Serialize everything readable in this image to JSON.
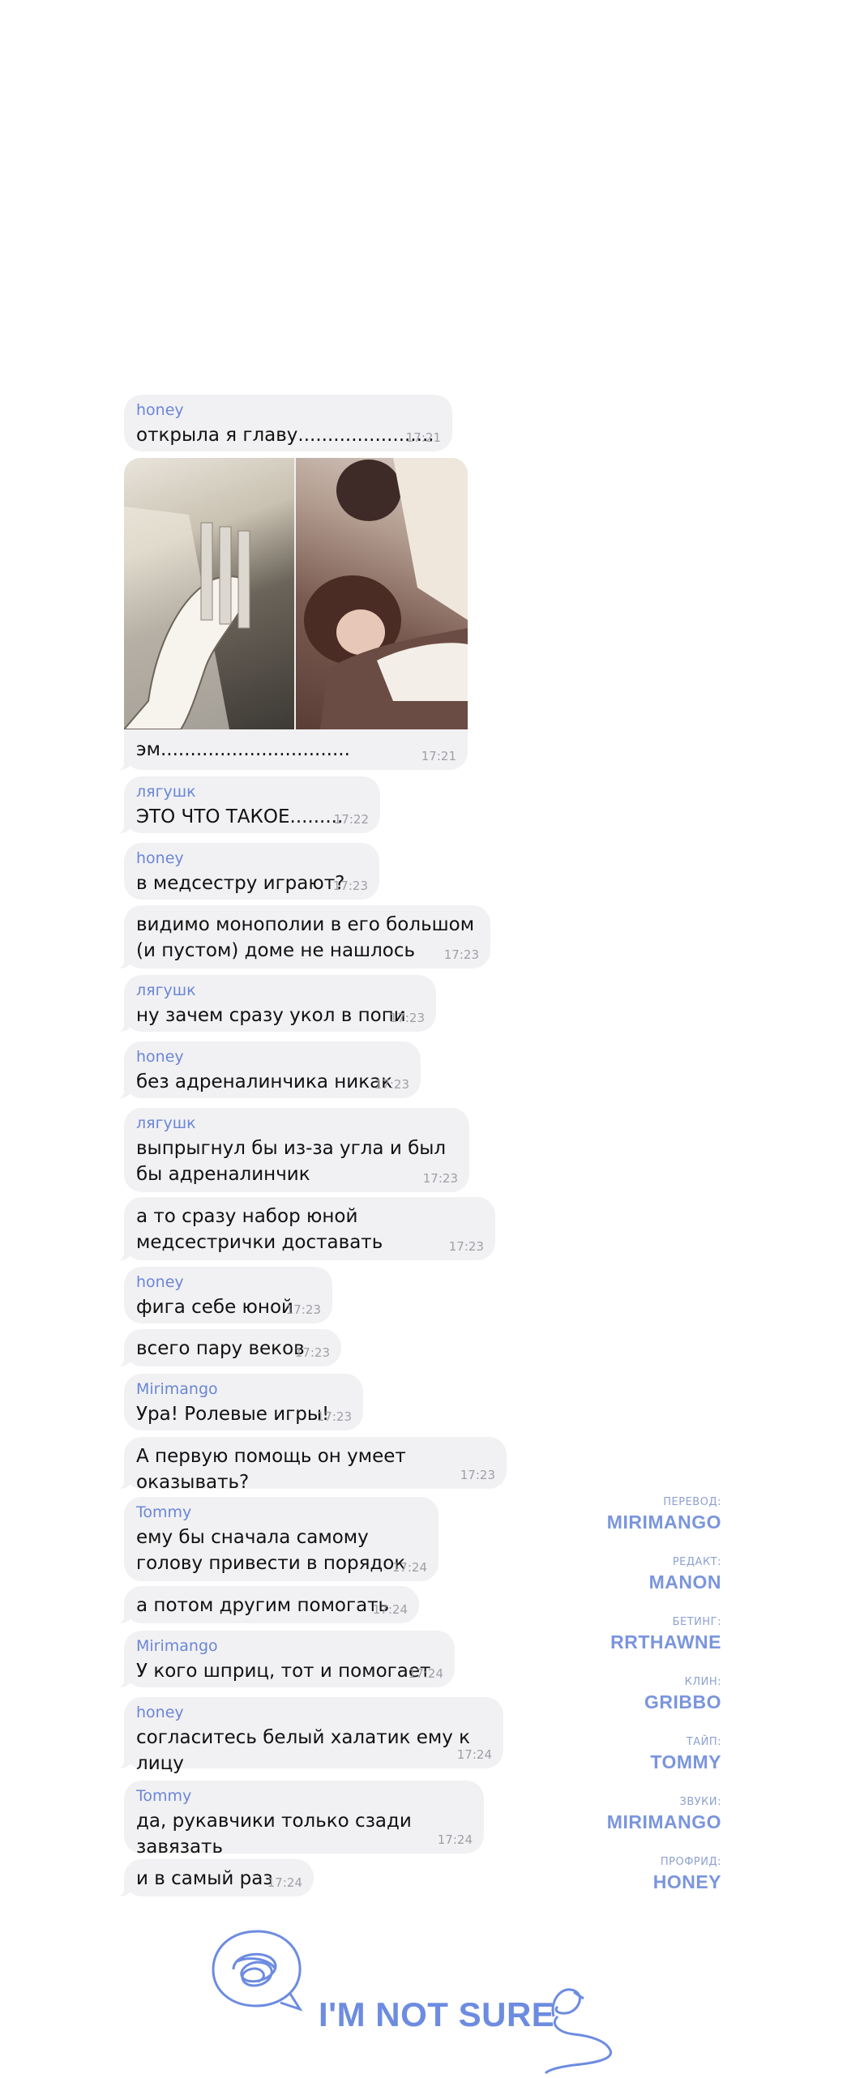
{
  "messages": [
    {
      "sender": "honey",
      "text": "открыла я главу.......................",
      "time": "17:21"
    },
    {
      "sender": "",
      "text": "эм................................",
      "time": "17:21"
    },
    {
      "sender": "лягушк",
      "text": "ЭТО ЧТО ТАКОЕ.........",
      "time": "17:22"
    },
    {
      "sender": "honey",
      "text": "в медсестру играют?",
      "time": "17:23"
    },
    {
      "sender": "",
      "text": "видимо монополии в его большом (и пустом) доме не нашлось",
      "time": "17:23"
    },
    {
      "sender": "лягушк",
      "text": "ну зачем сразу укол в попи",
      "time": "17:23"
    },
    {
      "sender": "honey",
      "text": "без адреналинчика никак",
      "time": "17:23"
    },
    {
      "sender": "лягушк",
      "text": "выпрыгнул бы из-за угла и был бы адреналинчик",
      "time": "17:23"
    },
    {
      "sender": "",
      "text": "а то сразу набор юной медсестрички доставать",
      "time": "17:23"
    },
    {
      "sender": "honey",
      "text": "фига себе юной",
      "time": "17:23"
    },
    {
      "sender": "",
      "text": "всего пару веков",
      "time": "17:23"
    },
    {
      "sender": "Mirimango",
      "text": "Ура! Ролевые игры!",
      "time": "17:23"
    },
    {
      "sender": "",
      "text": "А первую помощь он умеет оказывать?",
      "time": "17:23"
    },
    {
      "sender": "Tommy",
      "text": "ему бы сначала самому голову привести в порядок",
      "time": "17:24"
    },
    {
      "sender": "",
      "text": "а потом другим помогать",
      "time": "17:24"
    },
    {
      "sender": "Mirimango",
      "text": "У кого шприц, тот и помогает",
      "time": "17:24"
    },
    {
      "sender": "honey",
      "text": "согласитесь белый халатик ему к лицу",
      "time": "17:24"
    },
    {
      "sender": "Tommy",
      "text": "да, рукавчики только сзади завязать",
      "time": "17:24"
    },
    {
      "sender": "",
      "text": "и в самый раз",
      "time": "17:24"
    }
  ],
  "credits": [
    {
      "role": "ПЕРЕВОД:",
      "name": "MIRIMANGO"
    },
    {
      "role": "РЕДАКТ:",
      "name": "MANON"
    },
    {
      "role": "БЕТИНГ:",
      "name": "RRTHAWNE"
    },
    {
      "role": "КЛИН:",
      "name": "GRIBBO"
    },
    {
      "role": "ТАЙП:",
      "name": "TOMMY"
    },
    {
      "role": "ЗВУКИ:",
      "name": "MIRIMANGO"
    },
    {
      "role": "ПРОФРИД:",
      "name": "HONEY"
    }
  ],
  "footer": {
    "brand": "I'M NOT SURE"
  },
  "colors": {
    "bubble": "#f1f1f3",
    "sender": "#6b86d6",
    "time": "#9ea0a6",
    "credit": "#7b95dd"
  }
}
